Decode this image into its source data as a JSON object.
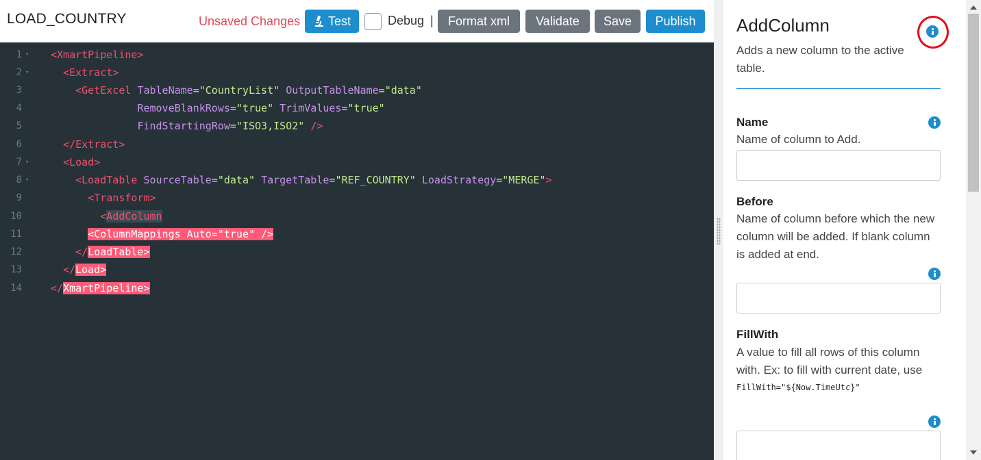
{
  "header": {
    "title": "LOAD_COUNTRY",
    "unsaved": "Unsaved Changes",
    "test_label": "Test",
    "debug_label": "Debug",
    "separator": "|",
    "format_label": "Format xml",
    "validate_label": "Validate",
    "save_label": "Save",
    "publish_label": "Publish",
    "debug_checked": false
  },
  "editor": {
    "lines": [
      {
        "n": "1",
        "fold": "▾"
      },
      {
        "n": "2",
        "fold": "▾"
      },
      {
        "n": "3",
        "fold": ""
      },
      {
        "n": "4",
        "fold": ""
      },
      {
        "n": "5",
        "fold": ""
      },
      {
        "n": "6",
        "fold": ""
      },
      {
        "n": "7",
        "fold": "▾"
      },
      {
        "n": "8",
        "fold": "▾"
      },
      {
        "n": "9",
        "fold": ""
      },
      {
        "n": "10",
        "fold": ""
      },
      {
        "n": "11",
        "fold": ""
      },
      {
        "n": "12",
        "fold": ""
      },
      {
        "n": "13",
        "fold": ""
      },
      {
        "n": "14",
        "fold": ""
      }
    ],
    "tok": {
      "l1": "<XmartPipeline>",
      "l2": "<Extract>",
      "l3_tag": "<GetExcel",
      "l3_a1": "TableName",
      "l3_v1": "\"CountryList\"",
      "l3_a2": "OutputTableName",
      "l3_v2": "\"data\"",
      "l4_a1": "RemoveBlankRows",
      "l4_v1": "\"true\"",
      "l4_a2": "TrimValues",
      "l4_v2": "\"true\"",
      "l5_a1": "FindStartingRow",
      "l5_v1": "\"ISO3,ISO2\"",
      "l5_end": "/>",
      "l6": "</Extract>",
      "l7": "<Load>",
      "l8_tag": "<LoadTable",
      "l8_a1": "SourceTable",
      "l8_v1": "\"data\"",
      "l8_a2": "TargetTable",
      "l8_v2": "\"REF_COUNTRY\"",
      "l8_a3": "LoadStrategy",
      "l8_v3": "\"MERGE\"",
      "l8_end": ">",
      "l9": "<Transform>",
      "l10_lt": "<",
      "l10_name": "AddColumn",
      "l11": "<ColumnMappings Auto=\"true\" />",
      "l12_lt": "</",
      "l12_name": "LoadTable>",
      "l13_lt": "</",
      "l13_name": "Load>",
      "l14_lt": "</",
      "l14_name": "XmartPipeline>",
      "eq": "="
    }
  },
  "panel": {
    "title": "AddColumn",
    "description": "Adds a new column to the active table.",
    "fields": [
      {
        "label": "Name",
        "description": "Name of column to Add.",
        "value": ""
      },
      {
        "label": "Before",
        "description": "Name of column before which the new column will be added. If blank column is added at end.",
        "value": ""
      },
      {
        "label": "FillWith",
        "description": "A value to fill all rows of this column with. Ex: to fill with current date, use",
        "example": "FillWith=\"${Now.TimeUtc}\"",
        "value": ""
      }
    ]
  },
  "colors": {
    "accent": "#1d8dcd",
    "editor_bg": "#263238",
    "tag": "#f0506e",
    "attr": "#c792ea",
    "string": "#c3e88d",
    "error_highlight": "#ff5a78",
    "unsaved": "#e0485a",
    "annotation_circle": "#e0111c"
  }
}
